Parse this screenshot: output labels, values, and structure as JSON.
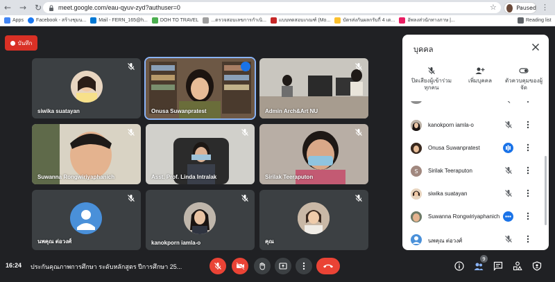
{
  "browser": {
    "url": "meet.google.com/eau-qyuv-zyd?authuser=0",
    "profile_status": "Paused",
    "bookmarks": [
      {
        "label": "Apps",
        "color": "#4285f4"
      },
      {
        "label": "Facebook - สร้างชุมน...",
        "color": "#1877f2"
      },
      {
        "label": "Mail - FERN_165@h...",
        "color": "#0078d4"
      },
      {
        "label": "DOH TO TRAVEL",
        "color": "#4caf50"
      },
      {
        "label": "...ตรวจสอบเลขการกำเนิ...",
        "color": "#9e9e9e"
      },
      {
        "label": "แบบทดสอบเกณฑ์ (Mo...",
        "color": "#c62828"
      },
      {
        "label": "บัตรส่งกันผลกรับกี่ 4 เด...",
        "color": "#fbc02d"
      },
      {
        "label": "อัพลงส่วนักทางภาษ |...",
        "color": "#e91e63"
      }
    ],
    "reading_list": "Reading list"
  },
  "meet": {
    "record_label": "บันทึก",
    "tiles": [
      {
        "name": "siwika suatayan",
        "muted": true
      },
      {
        "name": "Onusa Suwanpratest",
        "muted": false
      },
      {
        "name": "Admin Arch&Art NU",
        "muted": true
      },
      {
        "name": "Suwanna Rongwiriyaphanich",
        "muted": true
      },
      {
        "name": "Asst. Prof. Linda Intralak",
        "muted": true
      },
      {
        "name": "Sirilak Teeraputon",
        "muted": true
      },
      {
        "name": "นพคุณ ต่อวงศ์",
        "muted": true
      },
      {
        "name": "kanokporn iamla-o",
        "muted": true
      },
      {
        "name": "คุณ",
        "muted": true
      }
    ],
    "clock": "16:24",
    "meeting_title": "ประกันคุณภาพการศึกษา ระดับหลักสูตร ปีการศึกษา 25...",
    "people_count": "9"
  },
  "panel": {
    "title": "บุคคล",
    "actions": [
      {
        "label": "ปิดเสียงผู้เข้าร่วมทุกคน"
      },
      {
        "label": "เพิ่มบุคคล"
      },
      {
        "label": "ตัวควบคุมของผู้จัด"
      }
    ],
    "people": [
      {
        "name": "kanokporn iamla-o",
        "avatar_color": "#8d6e63",
        "initial": "",
        "speaking": false
      },
      {
        "name": "Onusa Suwanpratest",
        "avatar_color": "#5d4037",
        "initial": "",
        "speaking": true
      },
      {
        "name": "Sirilak Teeraputon",
        "avatar_color": "#a1887f",
        "initial": "S",
        "speaking": false
      },
      {
        "name": "siwika suatayan",
        "avatar_color": "#e0c4a8",
        "initial": "",
        "speaking": false
      },
      {
        "name": "Suwanna Rongwiriyaphanich",
        "avatar_color": "#78909c",
        "initial": "",
        "speaking": false,
        "more_active": true
      },
      {
        "name": "นพคุณ ต่อวงศ์",
        "avatar_color": "#4a90d9",
        "initial": "",
        "speaking": false
      }
    ]
  },
  "colors": {
    "meet_bg": "#202124",
    "tile_bg": "#3c4043",
    "accent": "#1a73e8",
    "danger": "#ea4335"
  }
}
